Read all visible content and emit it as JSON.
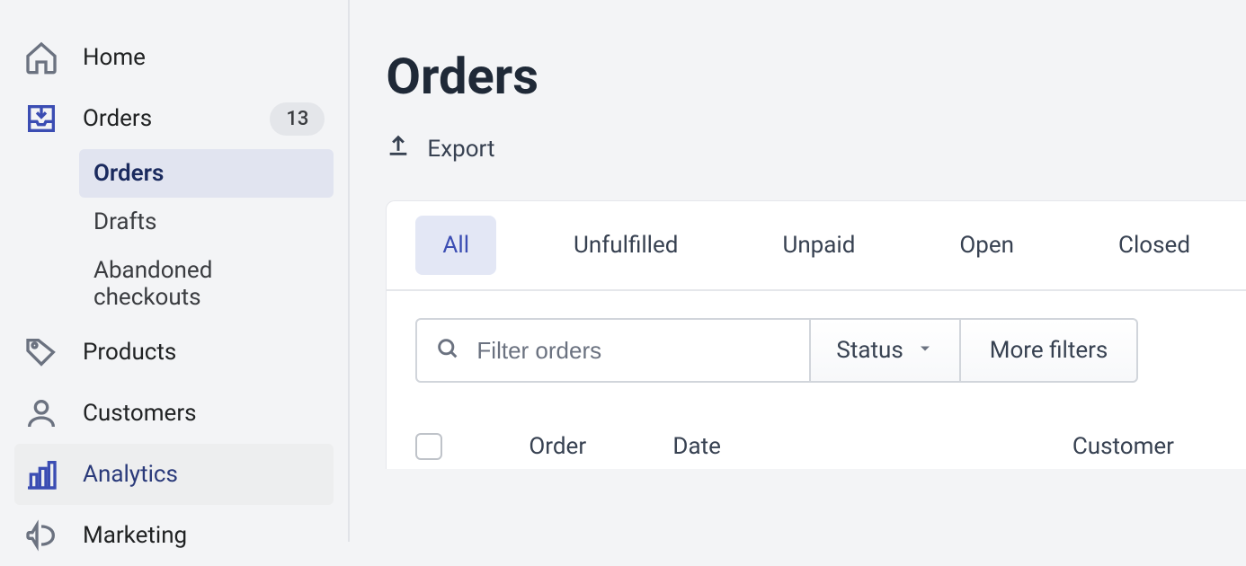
{
  "sidebar": {
    "items": [
      {
        "label": "Home"
      },
      {
        "label": "Orders",
        "badge": "13"
      },
      {
        "label": "Products"
      },
      {
        "label": "Customers"
      },
      {
        "label": "Analytics"
      },
      {
        "label": "Marketing"
      }
    ],
    "orders_sub": [
      {
        "label": "Orders"
      },
      {
        "label": "Drafts"
      },
      {
        "label": "Abandoned checkouts"
      }
    ]
  },
  "main": {
    "title": "Orders",
    "export_label": "Export",
    "tabs": [
      {
        "label": "All"
      },
      {
        "label": "Unfulfilled"
      },
      {
        "label": "Unpaid"
      },
      {
        "label": "Open"
      },
      {
        "label": "Closed"
      }
    ],
    "filter_placeholder": "Filter orders",
    "status_label": "Status",
    "more_filters_label": "More filters",
    "columns": {
      "order": "Order",
      "date": "Date",
      "customer": "Customer"
    }
  }
}
